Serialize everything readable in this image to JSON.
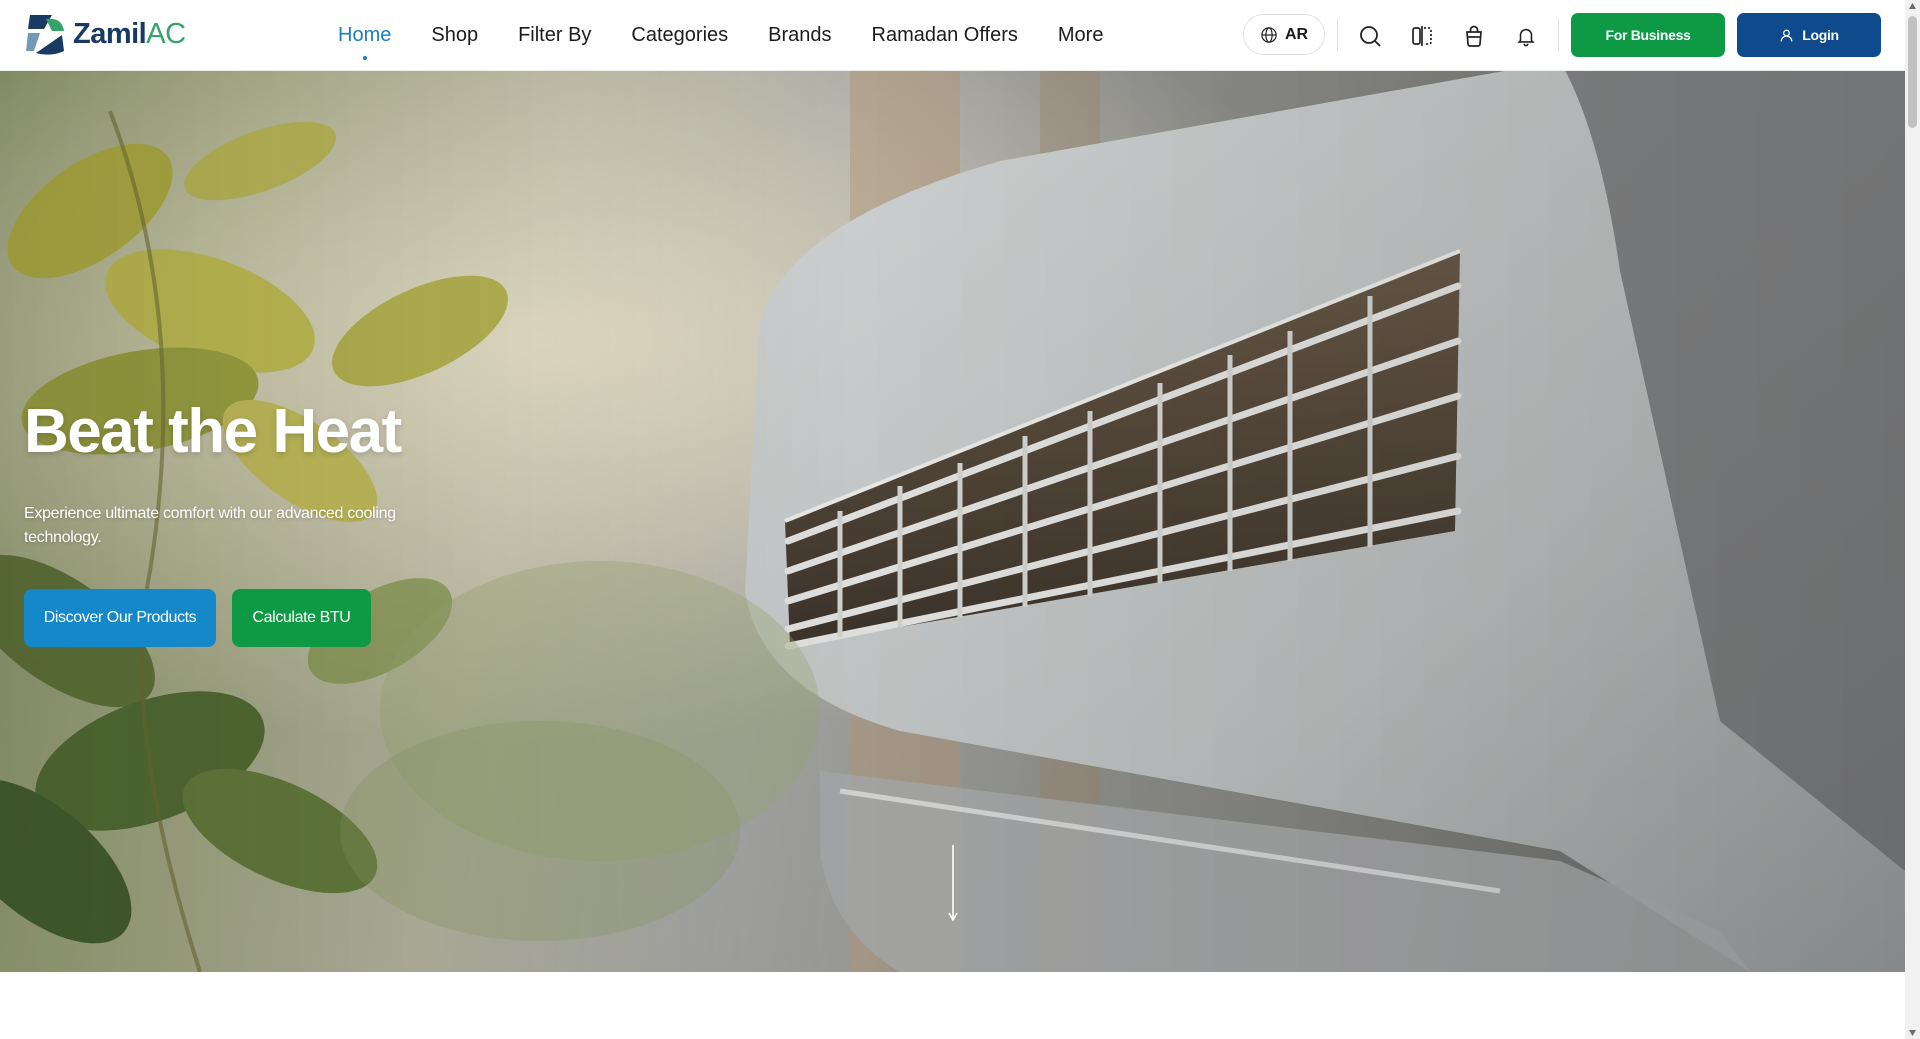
{
  "brand": {
    "name_part1": "Zamil",
    "name_part2": "AC"
  },
  "nav": {
    "items": [
      {
        "label": "Home",
        "active": true
      },
      {
        "label": "Shop",
        "active": false
      },
      {
        "label": "Filter By",
        "active": false
      },
      {
        "label": "Categories",
        "active": false
      },
      {
        "label": "Brands",
        "active": false
      },
      {
        "label": "Ramadan Offers",
        "active": false
      },
      {
        "label": "More",
        "active": false
      }
    ]
  },
  "header_actions": {
    "language_label": "AR",
    "icons": [
      "globe-icon",
      "search-icon",
      "compare-icon",
      "cart-bag-icon",
      "bell-icon",
      "user-icon"
    ],
    "business_label": "For Business",
    "login_label": "Login"
  },
  "hero": {
    "title": "Beat the Heat",
    "subtitle": "Experience ultimate comfort with our advanced cooling technology.",
    "primary_button": "Discover Our Products",
    "secondary_button": "Calculate BTU",
    "image_subject": "Wall-mounted air conditioner unit beside green plant leaves"
  },
  "colors": {
    "accent_blue": "#1a7fc1",
    "primary_button_blue": "#1488c9",
    "brand_green": "#0e9a45",
    "login_navy": "#0e4a8c"
  }
}
